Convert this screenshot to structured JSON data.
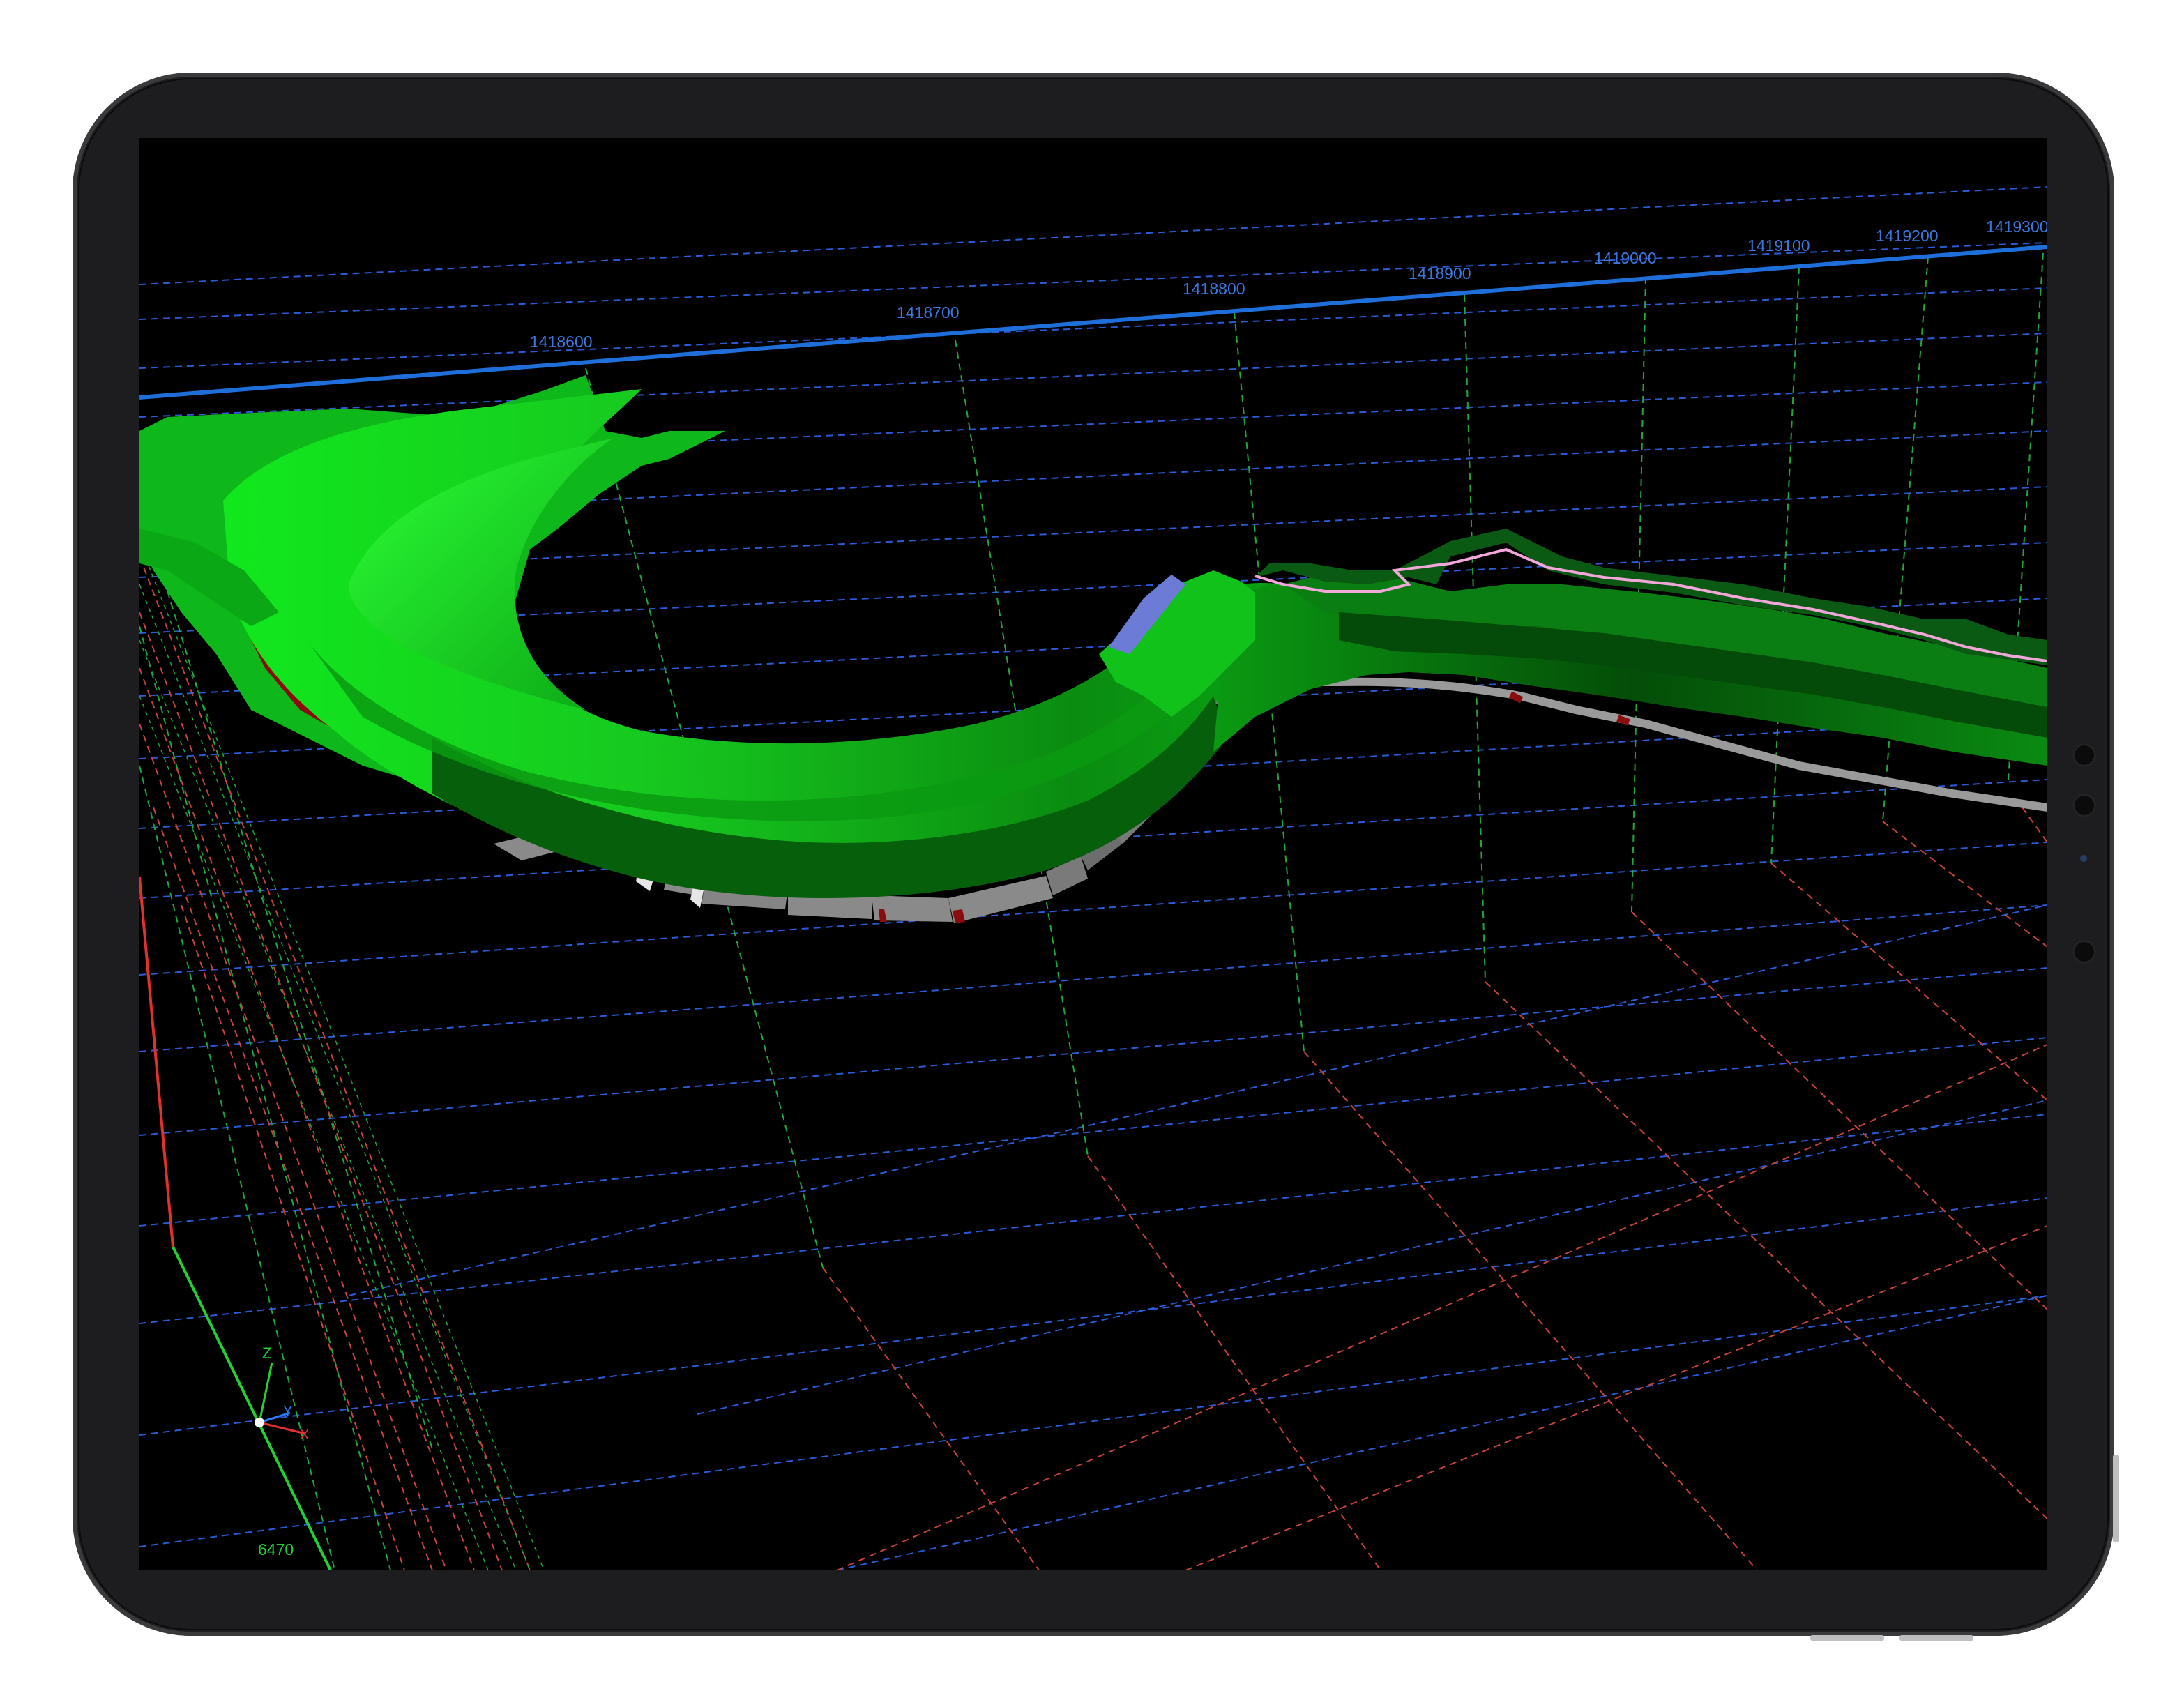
{
  "viewport": {
    "background": "#000000",
    "ruler_color": "#1e6fd9",
    "grid_colors": {
      "blue": "#2a5bd8",
      "green": "#1fa83a",
      "red": "#c8443a"
    },
    "surface_colors": {
      "green": "#13c21e",
      "dark_green": "#045a0a",
      "red": "#8a0c0c",
      "purple": "#6b7bd6",
      "gray": "#8a8a8a"
    },
    "top_axis_labels": [
      "1418600",
      "1418700",
      "1418800",
      "1418900",
      "1419000",
      "1419100",
      "1419200",
      "1419300"
    ],
    "elevation_label": "6470",
    "triad": {
      "z": "Z",
      "y": "Y",
      "x": "X"
    }
  }
}
